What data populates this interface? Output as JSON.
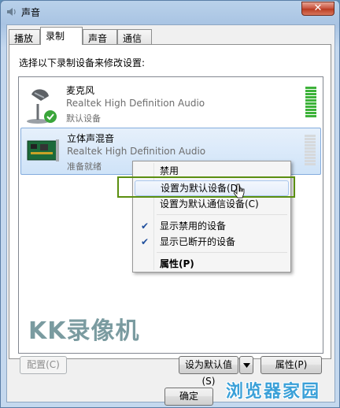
{
  "window": {
    "title": "声音",
    "close_glyph": "✕"
  },
  "tabs": [
    {
      "label": "播放"
    },
    {
      "label": "录制"
    },
    {
      "label": "声音"
    },
    {
      "label": "通信"
    }
  ],
  "instruction": "选择以下录制设备来修改设置:",
  "devices": [
    {
      "name": "麦克风",
      "driver": "Realtek High Definition Audio",
      "status": "默认设备",
      "icon": "microphone-icon"
    },
    {
      "name": "立体声混音",
      "driver": "Realtek High Definition Audio",
      "status": "准备就绪",
      "icon": "sound-card-icon"
    }
  ],
  "context_menu": {
    "items": [
      {
        "label": "禁用"
      },
      {
        "label": "设置为默认设备(D)"
      },
      {
        "label": "设置为默认通信设备(C)"
      },
      {
        "label": "显示禁用的设备"
      },
      {
        "label": "显示已断开的设备"
      },
      {
        "label": "属性(P)"
      }
    ]
  },
  "watermark": "KK录像机",
  "buttons": {
    "configure": "配置(C)",
    "set_default": "设为默认值(S)",
    "properties": "属性(P)",
    "ok": "确定"
  },
  "logo": "浏览器家园",
  "colors": {
    "meter_green": "#3db23a",
    "selection_border": "#84acdd",
    "highlight_box": "#5b8f10"
  }
}
